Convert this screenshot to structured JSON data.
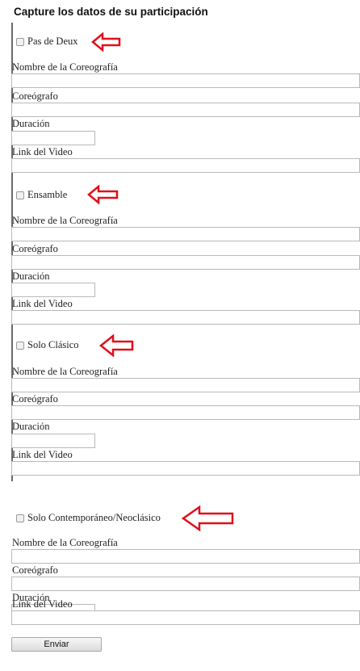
{
  "form": {
    "title": "Capture los datos de su participación",
    "submit_label": "Enviar",
    "sections": [
      {
        "checkbox_label": "Pas de Deux"
      },
      {
        "checkbox_label": "Ensamble"
      },
      {
        "checkbox_label": "Solo Clásico"
      },
      {
        "checkbox_label": "Solo Contemporáneo/Neoclásico"
      }
    ],
    "fields": {
      "nombre": "Nombre de la Coreografía",
      "coreografo": "Coreógrafo",
      "duracion": "Duración",
      "link": "Link del Video"
    }
  },
  "annotation": {
    "arrow_color": "#e0101a",
    "arrow_icon": "left-arrow-icon"
  }
}
